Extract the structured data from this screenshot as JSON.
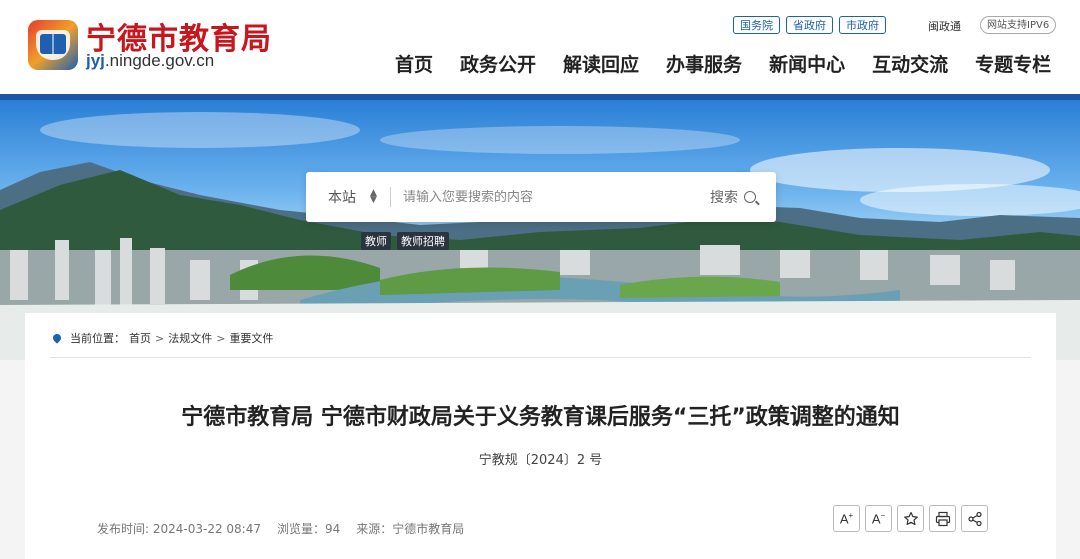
{
  "site": {
    "title": "宁德市教育局",
    "domain_prefix": "jyj",
    "domain_rest": ".ningde.gov.cn"
  },
  "top_links": [
    "国务院",
    "省政府",
    "市政府"
  ],
  "min_link": "闽政通",
  "ipv6_label": "网站支持IPV6",
  "nav": [
    "首页",
    "政务公开",
    "解读回应",
    "办事服务",
    "新闻中心",
    "互动交流",
    "专题专栏"
  ],
  "search": {
    "scope": "本站",
    "placeholder": "请输入您要搜索的内容",
    "button": "搜索"
  },
  "hot_tags": [
    "教师",
    "教师招聘"
  ],
  "breadcrumb": {
    "label": "当前位置：",
    "items": [
      "首页",
      "法规文件",
      "重要文件"
    ],
    "separator": ">"
  },
  "article": {
    "title": "宁德市教育局 宁德市财政局关于义务教育课后服务“三托”政策调整的通知",
    "doc_number": "宁教规〔2024〕2 号",
    "published": "发布时间: 2024-03-22 08:47",
    "views": "浏览量：94",
    "source": "来源：宁德市教育局"
  },
  "tools": {
    "font_increase": "A",
    "font_decrease": "A",
    "icons": [
      "font-increase-icon",
      "font-decrease-icon",
      "star-icon",
      "print-icon",
      "share-icon"
    ]
  },
  "colors": {
    "brand_red": "#c8161d",
    "brand_blue": "#1d57a3"
  }
}
